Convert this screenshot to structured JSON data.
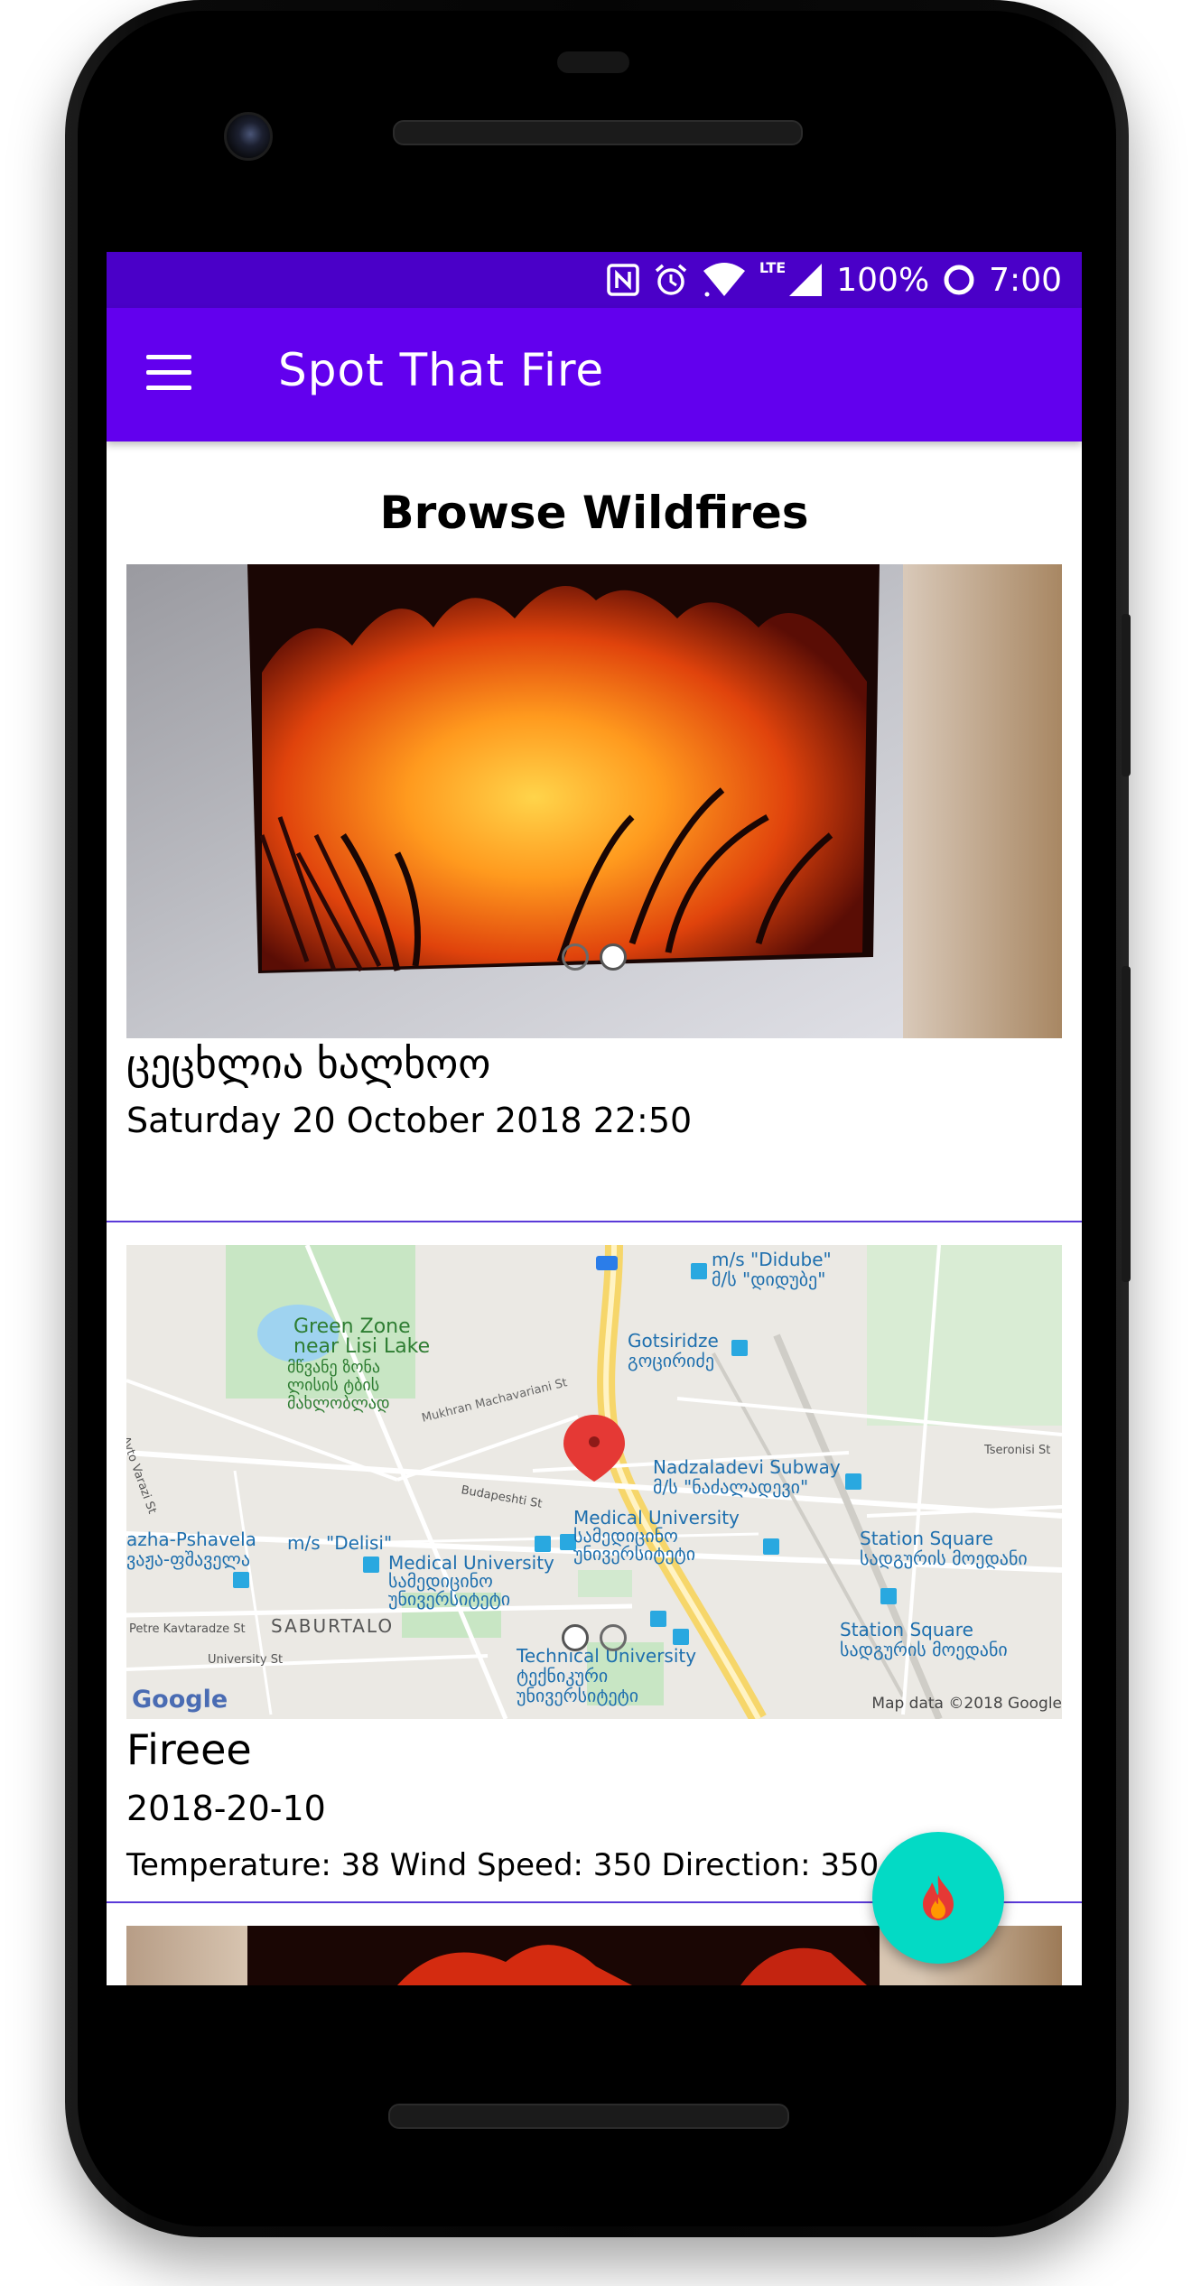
{
  "status_bar": {
    "battery": "100%",
    "time": "7:00",
    "network": "LTE",
    "icons": [
      "nfc-icon",
      "alarm-icon",
      "wifi-icon",
      "signal-icon",
      "battery-icon"
    ]
  },
  "app_bar": {
    "title": "Spot That Fire",
    "menu_icon": "menu-icon"
  },
  "page": {
    "heading": "Browse Wildfires"
  },
  "wildfires": [
    {
      "title": "ცეცხლია ხალხოო",
      "date": "Saturday 20 October 2018 22:50",
      "image": "wildfire-photo",
      "carousel_dots": 2
    },
    {
      "title": "Fireee",
      "date": "2018-20-10",
      "details": "Temperature: 38 Wind Speed: 350 Direction: 350",
      "image": "map-snapshot",
      "carousel_dots": 2,
      "map": {
        "labels": [
          "Green Zone\nnear Lisi Lake",
          "მწვანე ზონა\nლისის ტბის\nმახლობლად",
          "Mukhran Machavariani St",
          "Gotsiridze\nგოცირიძე",
          "m/s \"Didube\"\nმ/ს \"დიდუბე\"",
          "Nadzaladevi Subway\nმ/ს \"ნაძალადევი\"",
          "Medical University\nსამედიცინო\nუნივერსიტეტი",
          "m/s \"Delisi\"",
          "Station Square\nსადგურის მოედანი",
          "SABURTALO",
          "Technical University\nტექნიკური\nუნივერსიტეტი",
          "Petre Kavtaradze St",
          "University St",
          "Budapeshti St",
          "Tseronisi St",
          "Avto Varazi St",
          "azha-Pshavela\nვაჟა-ფშაველა"
        ],
        "attribution": "Map data ©2018 Google",
        "logo": "Google",
        "route_badge": "​"
      }
    }
  ],
  "fab": {
    "icon": "fire-icon"
  },
  "colors": {
    "status_bar": "#4a00c8",
    "app_bar": "#6200ee",
    "fab": "#03dac5",
    "divider": "#5a3ad8"
  }
}
